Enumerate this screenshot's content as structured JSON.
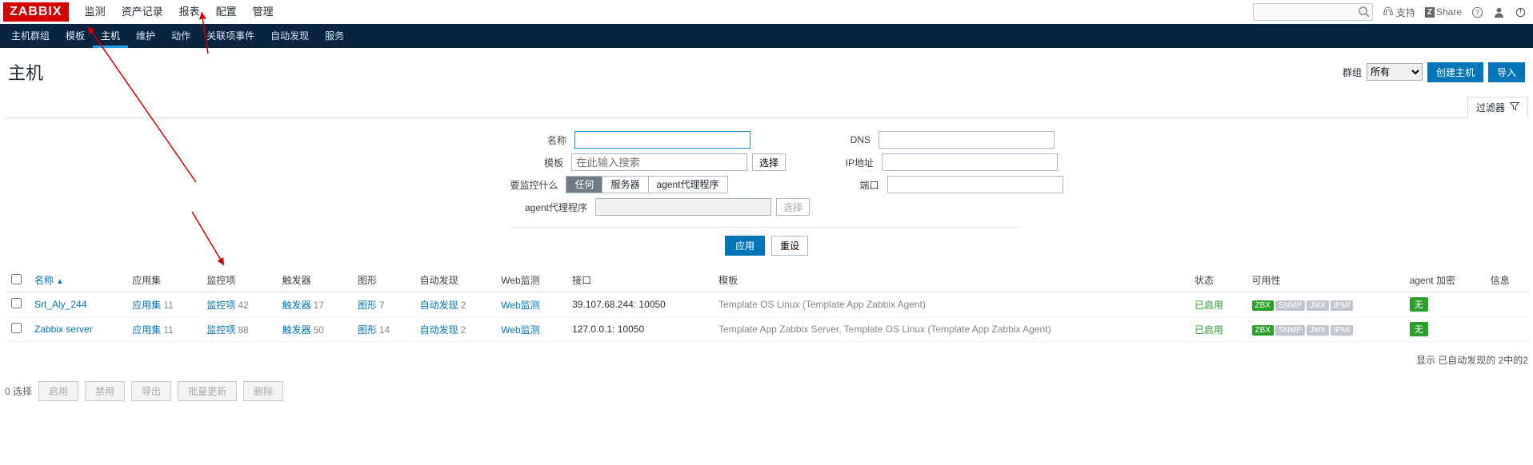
{
  "logo": "ZABBIX",
  "top_menu": [
    "监测",
    "资产记录",
    "报表",
    "配置",
    "管理"
  ],
  "top_right": {
    "support": "支持",
    "share": "Share"
  },
  "search": {
    "placeholder": ""
  },
  "subnav": [
    "主机群组",
    "模板",
    "主机",
    "维护",
    "动作",
    "关联项事件",
    "自动发现",
    "服务"
  ],
  "subnav_active_index": 2,
  "page_title": "主机",
  "header_right": {
    "group_label": "群组",
    "group_selected": "所有",
    "create_host": "创建主机",
    "import": "导入"
  },
  "filter_tab": "过滤器",
  "filter": {
    "name_label": "名称",
    "template_label": "模板",
    "template_placeholder": "在此输入搜索",
    "template_select": "选择",
    "monitor_label": "要监控什么",
    "seg_options": [
      "任何",
      "服务器",
      "agent代理程序"
    ],
    "seg_active_index": 0,
    "proxy_label": "agent代理程序",
    "proxy_select": "选择",
    "dns_label": "DNS",
    "ip_label": "IP地址",
    "port_label": "端口",
    "apply": "应用",
    "reset": "重设"
  },
  "table": {
    "columns": {
      "name": "名称",
      "apps": "应用集",
      "items": "监控项",
      "triggers": "触发器",
      "graphs": "图形",
      "discovery": "自动发现",
      "web": "Web监测",
      "interface": "接口",
      "templates": "模板",
      "status": "状态",
      "availability": "可用性",
      "encryption": "agent 加密",
      "info": "信息"
    },
    "rows": [
      {
        "name": "Srt_Aly_244",
        "apps": "应用集",
        "apps_count": "11",
        "items": "监控项",
        "items_count": "42",
        "triggers": "触发器",
        "triggers_count": "17",
        "graphs": "图形",
        "graphs_count": "7",
        "discovery": "自动发现",
        "discovery_count": "2",
        "web": "Web监测",
        "interface": "39.107.68.244: 10050",
        "templates": "Template OS Linux (Template App Zabbix Agent)",
        "status": "已启用",
        "avail": [
          "ZBX",
          "SNMP",
          "JMX",
          "IPMI"
        ],
        "enc": "无"
      },
      {
        "name": "Zabbix server",
        "apps": "应用集",
        "apps_count": "11",
        "items": "监控项",
        "items_count": "88",
        "triggers": "触发器",
        "triggers_count": "50",
        "graphs": "图形",
        "graphs_count": "14",
        "discovery": "自动发现",
        "discovery_count": "2",
        "web": "Web监测",
        "interface": "127.0.0.1: 10050",
        "templates": "Template App Zabbix Server, Template OS Linux (Template App Zabbix Agent)",
        "status": "已启用",
        "avail": [
          "ZBX",
          "SNMP",
          "JMX",
          "IPMI"
        ],
        "enc": "无"
      }
    ]
  },
  "footer_summary": "显示 已自动发现的 2中的2",
  "selection": {
    "selected_label": "0 选择",
    "enable": "启用",
    "disable": "禁用",
    "export": "导出",
    "mass_update": "批量更新",
    "delete": "删除"
  }
}
